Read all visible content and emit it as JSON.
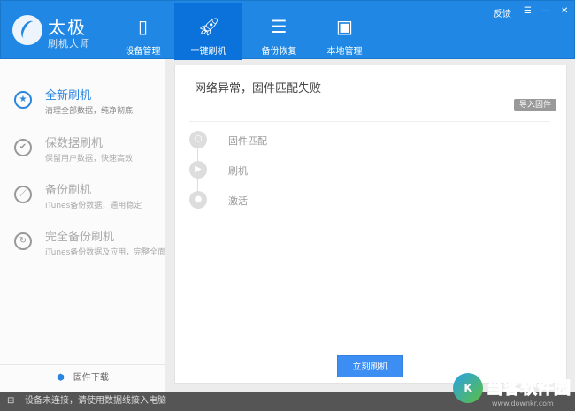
{
  "header": {
    "brand_title": "太极",
    "brand_subtitle": "刷机大师",
    "tabs": [
      {
        "label": "设备管理",
        "icon": "phone-icon"
      },
      {
        "label": "一键刷机",
        "icon": "rocket-icon",
        "active": true
      },
      {
        "label": "备份恢复",
        "icon": "database-icon"
      },
      {
        "label": "本地管理",
        "icon": "bag-icon"
      }
    ],
    "feedback": "反馈",
    "menu_icon": "☰",
    "minimize_icon": "—",
    "close_icon": "✕"
  },
  "sidebar": {
    "items": [
      {
        "title": "全新刷机",
        "subtitle": "清理全部数据，纯净彻底",
        "icon": "★",
        "active": true
      },
      {
        "title": "保数据刷机",
        "subtitle": "保留用户数据，快速高效",
        "icon": "✔"
      },
      {
        "title": "备份刷机",
        "subtitle": "iTunes备份数据，通用稳定",
        "icon": "⟋"
      },
      {
        "title": "完全备份刷机",
        "subtitle": "iTunes备份数据及应用，完整全面",
        "icon": "↻"
      }
    ],
    "firmware_download": "固件下载",
    "firmware_icon": "⬢"
  },
  "main": {
    "title": "网络异常，固件匹配失败",
    "import_button": "导入固件",
    "steps": [
      {
        "label": "固件匹配",
        "icon": "⬡"
      },
      {
        "label": "刷机",
        "icon": "▶"
      },
      {
        "label": "激活",
        "icon": "●"
      }
    ],
    "flash_button": "立刻刷机"
  },
  "status": {
    "icon": "⊟",
    "text": "设备未连接，请使用数据线接入电脑"
  },
  "watermark": {
    "name": "当客软件园",
    "url": "www.downkr.com",
    "logo": "K"
  }
}
